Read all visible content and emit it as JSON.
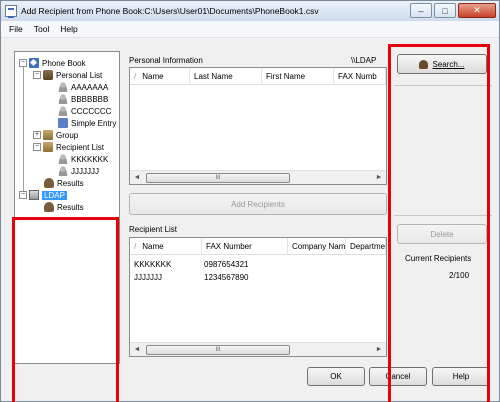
{
  "window": {
    "title": "Add Recipient from Phone Book:C:\\Users\\User01\\Documents\\PhoneBook1.csv",
    "minimize_glyph": "–",
    "maximize_glyph": "□",
    "close_glyph": "✕"
  },
  "menu": [
    "File",
    "Tool",
    "Help"
  ],
  "tree": {
    "root": "Phone Book",
    "personal_list": "Personal List",
    "personal_items": [
      "AAAAAAA",
      "BBBBBBB",
      "CCCCCCC"
    ],
    "simple_entry": "Simple Entry",
    "group": "Group",
    "recipient_list": "Recipient List",
    "recipient_items": [
      "KKKKKKK",
      "JJJJJJJ"
    ],
    "results": "Results",
    "ldap": "LDAP",
    "ldap_results": "Results",
    "expanded_glyph": "−",
    "collapsed_glyph": "+"
  },
  "personal_info": {
    "label": "Personal Information",
    "source": "\\\\LDAP",
    "columns": [
      "Name",
      "Last Name",
      "First Name",
      "FAX Numb"
    ],
    "scroll_left": "◄",
    "scroll_right": "►",
    "scroll_thumb": "III"
  },
  "buttons": {
    "search": "Search...",
    "add_recipients": "Add Recipients",
    "delete": "Delete",
    "ok": "OK",
    "cancel": "Cancel",
    "help": "Help"
  },
  "recipient_list": {
    "label": "Recipient List",
    "columns": [
      "Name",
      "FAX Number",
      "Company Name",
      "Departmen"
    ],
    "rows": [
      {
        "name": "KKKKKKK",
        "fax": "0987654321"
      },
      {
        "name": "JJJJJJJ",
        "fax": "1234567890"
      }
    ],
    "scroll_thumb": "III"
  },
  "current_recipients": {
    "label": "Current Recipients",
    "count": "2/100"
  },
  "colors": {
    "highlight": "#e8000b",
    "selection": "#3399ff"
  }
}
